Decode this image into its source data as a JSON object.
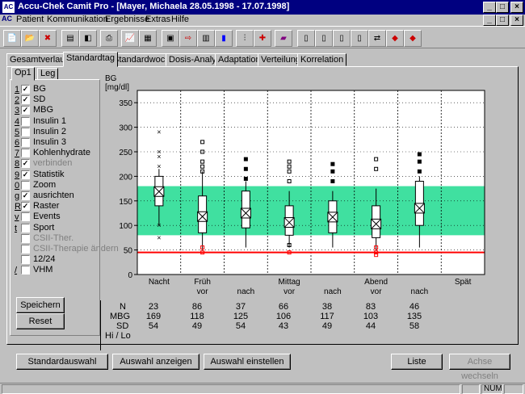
{
  "window": {
    "title": "Accu-Chek Camit Pro - [Mayer, Michaela 28.05.1998 - 17.07.1998]",
    "icon_text": "AC"
  },
  "menu": [
    "Patient",
    "Kommunikation",
    "Ergebnisse",
    "Extras",
    "Hilfe"
  ],
  "tabs": [
    "Gesamtverlauf",
    "Standardtag",
    "Standardwoche",
    "Dosis-Analyse",
    "Adaptation",
    "Verteilung",
    "Korrelation"
  ],
  "active_tab": "Standardtag",
  "subtabs": [
    "Op1",
    "Leg"
  ],
  "options": [
    {
      "num": "1",
      "label": "BG",
      "checked": true,
      "enabled": true
    },
    {
      "num": "2",
      "label": "SD",
      "checked": true,
      "enabled": true
    },
    {
      "num": "3",
      "label": "MBG",
      "checked": true,
      "enabled": true
    },
    {
      "num": "4",
      "label": "Insulin 1",
      "checked": false,
      "enabled": true
    },
    {
      "num": "5",
      "label": "Insulin 2",
      "checked": false,
      "enabled": true
    },
    {
      "num": "6",
      "label": "Insulin 3",
      "checked": false,
      "enabled": true
    },
    {
      "num": "7",
      "label": "Kohlenhydrate",
      "checked": false,
      "enabled": true
    },
    {
      "num": "8",
      "label": "verbinden",
      "checked": true,
      "enabled": false
    },
    {
      "num": "9",
      "label": "Statistik",
      "checked": true,
      "enabled": true
    },
    {
      "num": "0",
      "label": "Zoom",
      "checked": false,
      "enabled": true
    },
    {
      "num": "g",
      "label": "ausrichten",
      "checked": true,
      "enabled": true
    },
    {
      "num": "R",
      "label": "Raster",
      "checked": true,
      "enabled": true
    },
    {
      "num": "v",
      "label": "Events",
      "checked": false,
      "enabled": true
    },
    {
      "num": "t",
      "label": "Sport",
      "checked": false,
      "enabled": true
    },
    {
      "num": "",
      "label": "CSII-Ther.",
      "checked": false,
      "enabled": false
    },
    {
      "num": "",
      "label": "CSII-Therapie ändern",
      "checked": false,
      "enabled": false
    },
    {
      "num": "",
      "label": "12/24",
      "checked": false,
      "enabled": true
    },
    {
      "num": "/",
      "label": "VHM",
      "checked": false,
      "enabled": true
    }
  ],
  "buttons": {
    "save": "Speichern",
    "reset": "Reset",
    "default_selection": "Standardauswahl",
    "show_selection": "Auswahl anzeigen",
    "set_selection": "Auswahl einstellen",
    "list": "Liste",
    "swap_axis": "Achse wechseln"
  },
  "stats_labels": {
    "n": "N",
    "mbg": "MBG",
    "sd": "SD",
    "hilo": "Hi / Lo"
  },
  "stats": [
    {
      "n": "23",
      "mbg": "169",
      "sd": "54"
    },
    {
      "n": "86",
      "mbg": "118",
      "sd": "49"
    },
    {
      "n": "37",
      "mbg": "125",
      "sd": "54"
    },
    {
      "n": "66",
      "mbg": "106",
      "sd": "43"
    },
    {
      "n": "38",
      "mbg": "117",
      "sd": "49"
    },
    {
      "n": "83",
      "mbg": "103",
      "sd": "44"
    },
    {
      "n": "46",
      "mbg": "135",
      "sd": "58"
    }
  ],
  "status": {
    "num": "NUM"
  },
  "chart_data": {
    "type": "box",
    "ylabel": "BG",
    "yunit": "[mg/dl]",
    "ylim": [
      0,
      375
    ],
    "yticks": [
      0,
      50,
      100,
      150,
      200,
      250,
      300,
      350
    ],
    "target_range": [
      80,
      180
    ],
    "target_color": "#40e0a0",
    "hypo_line": 45,
    "hypo_color": "#ff0000",
    "grid": true,
    "x_top_labels": [
      "Nacht",
      "Früh",
      "",
      "Mittag",
      "",
      "Abend",
      "",
      "Spät"
    ],
    "x_bottom_labels": [
      "",
      "vor",
      "nach",
      "vor",
      "nach",
      "vor",
      "nach",
      ""
    ],
    "series": [
      {
        "name": "Nacht",
        "mean": 169,
        "sd": 54,
        "q1": 140,
        "q3": 200,
        "lo": 100,
        "hi": 215,
        "outliers": [
          290,
          250,
          240,
          220,
          75,
          100
        ]
      },
      {
        "name": "Früh vor",
        "mean": 118,
        "sd": 49,
        "q1": 85,
        "q3": 160,
        "lo": 50,
        "hi": 210,
        "outliers": [
          270,
          250,
          230,
          220,
          210,
          55,
          45
        ]
      },
      {
        "name": "Früh nach",
        "mean": 125,
        "sd": 54,
        "q1": 95,
        "q3": 170,
        "lo": 55,
        "hi": 190,
        "outliers": [
          235,
          215,
          195
        ]
      },
      {
        "name": "Mittag vor",
        "mean": 106,
        "sd": 43,
        "q1": 80,
        "q3": 140,
        "lo": 55,
        "hi": 170,
        "outliers": [
          230,
          220,
          210,
          190,
          60,
          45
        ]
      },
      {
        "name": "Mittag nach",
        "mean": 117,
        "sd": 49,
        "q1": 85,
        "q3": 150,
        "lo": 55,
        "hi": 170,
        "outliers": [
          225,
          210,
          190
        ]
      },
      {
        "name": "Abend vor",
        "mean": 103,
        "sd": 44,
        "q1": 75,
        "q3": 140,
        "lo": 50,
        "hi": 175,
        "outliers": [
          235,
          215,
          55,
          45,
          40
        ]
      },
      {
        "name": "Abend nach",
        "mean": 135,
        "sd": 58,
        "q1": 100,
        "q3": 190,
        "lo": 55,
        "hi": 200,
        "outliers": [
          245,
          230,
          210
        ]
      }
    ]
  }
}
